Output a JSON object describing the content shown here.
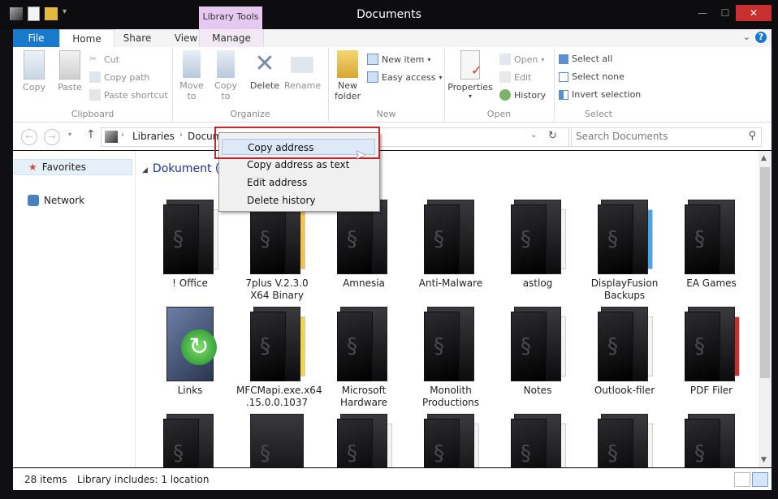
{
  "window": {
    "title": "Documents"
  },
  "ribbon_tabs": {
    "file": "File",
    "home": "Home",
    "share": "Share",
    "view": "View",
    "library_tools": "Library Tools",
    "manage": "Manage"
  },
  "ribbon": {
    "clipboard": {
      "label": "Clipboard",
      "copy": "Copy",
      "paste": "Paste",
      "cut": "Cut",
      "copy_path": "Copy path",
      "paste_shortcut": "Paste shortcut"
    },
    "organize": {
      "label": "Organize",
      "move_to": "Move",
      "move_to_sub": "to",
      "copy_to": "Copy",
      "copy_to_sub": "to",
      "delete": "Delete",
      "rename": "Rename"
    },
    "new": {
      "label": "New",
      "new_folder": "New",
      "new_folder_sub": "folder",
      "new_item": "New item",
      "easy_access": "Easy access"
    },
    "open": {
      "label": "Open",
      "properties": "Properties",
      "open": "Open",
      "edit": "Edit",
      "history": "History"
    },
    "select": {
      "label": "Select",
      "select_all": "Select all",
      "select_none": "Select none",
      "invert": "Invert selection"
    }
  },
  "address": {
    "crumb_root": "Libraries",
    "crumb_current": "Documents",
    "search_placeholder": "Search Documents"
  },
  "nav": {
    "favorites": "Favorites",
    "network": "Network"
  },
  "content": {
    "heading": "Dokument (2",
    "row1": [
      "! Office",
      "7plus V.2.3.0 X64 Binary",
      "Amnesia",
      "Anti-Malware",
      "astlog",
      "DisplayFusion Backups",
      "EA Games"
    ],
    "row2": [
      "Links",
      "MFCMapi.exe.x64 .15.0.0.1037",
      "Microsoft Hardware",
      "Monolith Productions",
      "Notes",
      "Outlook-filer",
      "PDF Filer"
    ]
  },
  "context_menu": {
    "copy_address": "Copy address",
    "copy_address_text": "Copy address as text",
    "edit_address": "Edit address",
    "delete_history": "Delete history"
  },
  "status": {
    "items": "28 items",
    "library": "Library includes: 1 location"
  },
  "colors": {
    "accent": "#1979ca",
    "library_tools": "#e6c9f0",
    "close": "#c7302f",
    "highlight": "#c4262a"
  }
}
